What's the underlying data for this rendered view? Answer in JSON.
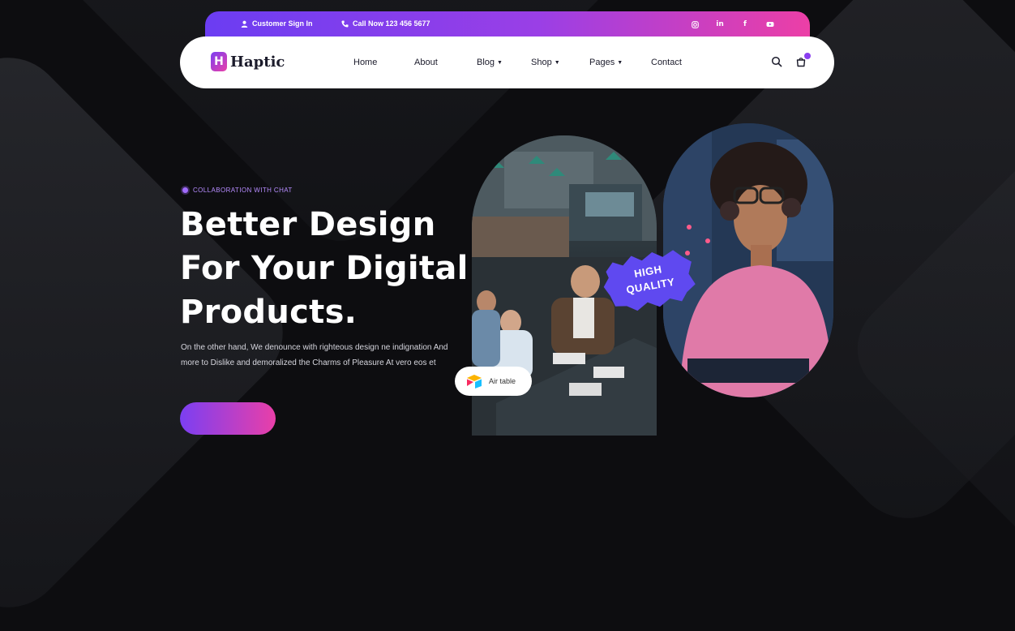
{
  "topbar": {
    "signin": "Customer Sign In",
    "phone": "Call Now 123 456 5677",
    "socials": [
      "instagram-icon",
      "linkedin-icon",
      "facebook-icon",
      "youtube-icon"
    ]
  },
  "nav": {
    "logo": "Haptic",
    "logo_initial": "H",
    "items": [
      {
        "label": "Home"
      },
      {
        "label": "About"
      },
      {
        "label": "Blog",
        "dropdown": true
      },
      {
        "label": "Shop",
        "dropdown": true
      },
      {
        "label": "Pages",
        "dropdown": true
      },
      {
        "label": "Contact"
      }
    ]
  },
  "hero": {
    "tagline": "COLLABORATION WITH CHAT",
    "title_lines": [
      "Better Design",
      "For Your Digital",
      "Products."
    ],
    "description": "On the other hand, We denounce with righteous design ne indignation And more to Dislike and demoralized the Charms of Pleasure At vero eos et",
    "badge_lines": [
      "HIGH",
      "QUALITY"
    ],
    "airtable_label": "Air table"
  },
  "colors": {
    "gradient_start": "#6b3df2",
    "gradient_mid": "#9a3fe6",
    "gradient_end": "#ec3fa6",
    "badge": "#5f49f0",
    "background": "#0d0d10"
  }
}
